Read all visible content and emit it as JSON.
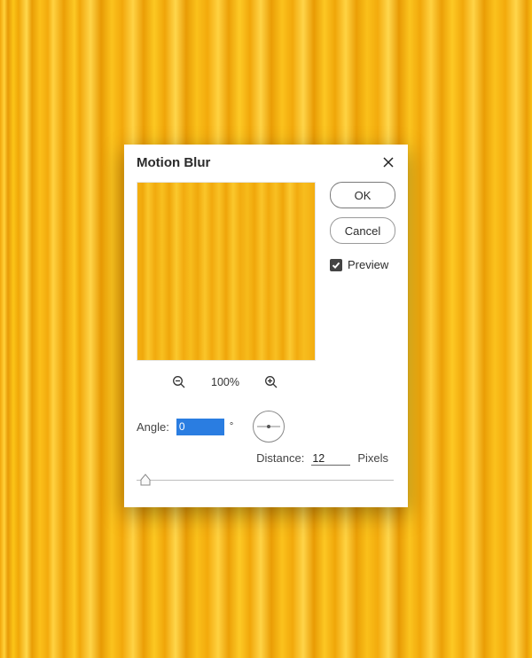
{
  "dialog": {
    "title": "Motion Blur",
    "ok_label": "OK",
    "cancel_label": "Cancel",
    "preview_label": "Preview",
    "preview_checked": true
  },
  "zoom": {
    "percent": "100%"
  },
  "angle": {
    "label": "Angle:",
    "value": "0",
    "degree_symbol": "°"
  },
  "distance": {
    "label": "Distance:",
    "value": "12",
    "unit": "Pixels"
  }
}
